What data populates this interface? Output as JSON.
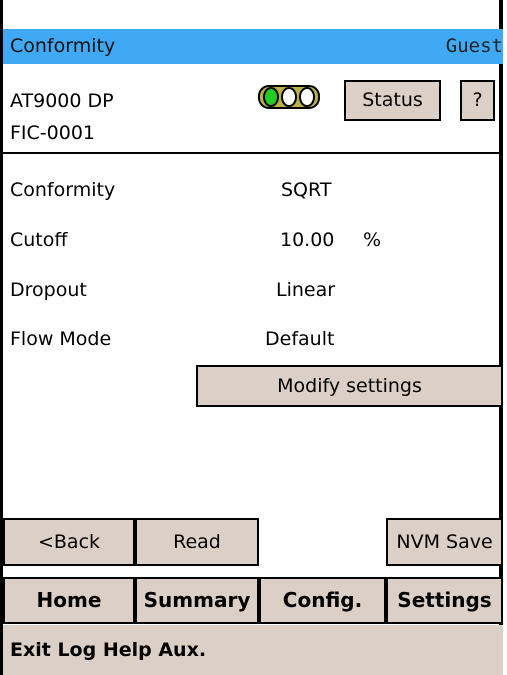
{
  "header": {
    "title": "Conformity",
    "user": "Guest"
  },
  "device": {
    "model": "AT9000 DP",
    "tag": "FIC-0001"
  },
  "toolbar": {
    "status_label": "Status",
    "help_label": "?"
  },
  "fields": [
    {
      "label": "Conformity",
      "value": "SQRT"
    },
    {
      "label": "Cutoff",
      "value": "10.00",
      "unit": "%"
    },
    {
      "label": "Dropout",
      "value": "Linear"
    },
    {
      "label": "Flow Mode",
      "value": "Default"
    }
  ],
  "actions": {
    "modify_label": "Modify settings",
    "back_label": "<Back",
    "read_label": "Read",
    "nvm_save_label": "NVM Save"
  },
  "tabs": [
    "Home",
    "Summary",
    "Config.",
    "Settings"
  ],
  "footer": {
    "menu": "Exit Log Help Aux."
  },
  "colors": {
    "titlebar": "#3fa9f5",
    "button": "#dccfc5",
    "indicator_active": "#22cc22"
  }
}
